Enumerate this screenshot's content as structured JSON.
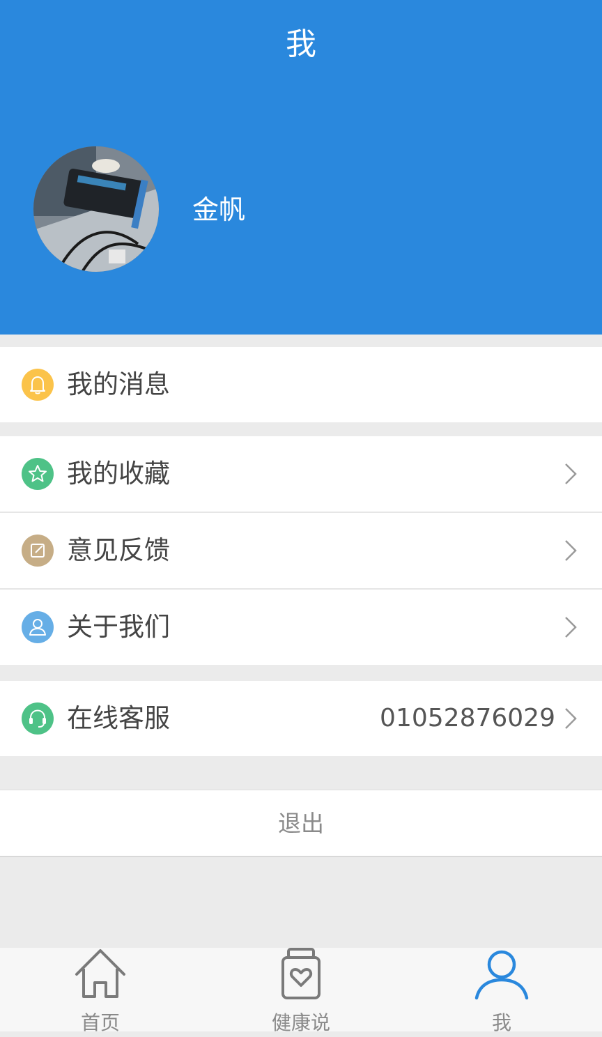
{
  "header": {
    "title": "我",
    "username": "金帆"
  },
  "menu": {
    "messages": {
      "label": "我的消息",
      "icon": "bell-icon",
      "color": "#fbc34a"
    },
    "favorites": {
      "label": "我的收藏",
      "icon": "star-icon",
      "color": "#4ec287"
    },
    "feedback": {
      "label": "意见反馈",
      "icon": "edit-icon",
      "color": "#c6ad86"
    },
    "about": {
      "label": "关于我们",
      "icon": "person-icon",
      "color": "#66aee6"
    },
    "support": {
      "label": "在线客服",
      "icon": "headset-icon",
      "color": "#4ec287",
      "phone": "01052876029"
    }
  },
  "logout": {
    "label": "退出"
  },
  "tabbar": {
    "items": [
      {
        "label": "首页",
        "icon": "home-icon",
        "active": false
      },
      {
        "label": "健康说",
        "icon": "heart-jar-icon",
        "active": false
      },
      {
        "label": "我",
        "icon": "user-icon",
        "active": true
      }
    ],
    "active_color": "#2a88dd",
    "inactive_color": "#7a7a7a"
  }
}
